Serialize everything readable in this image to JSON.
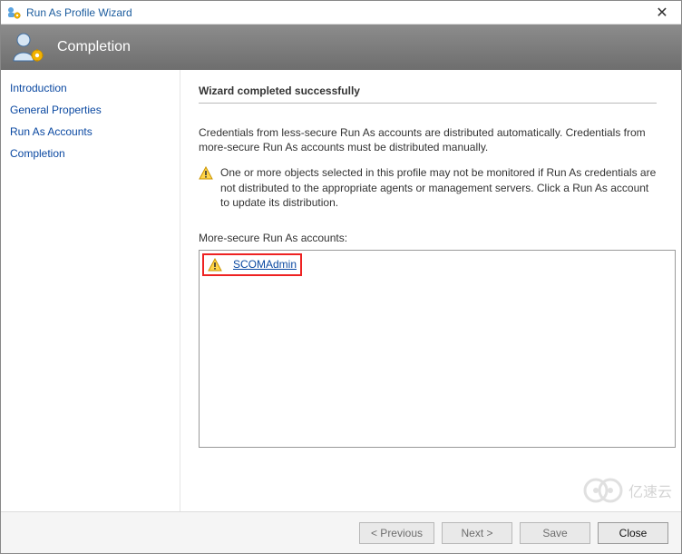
{
  "window": {
    "title": "Run As Profile Wizard"
  },
  "header": {
    "heading": "Completion"
  },
  "sidebar": {
    "items": [
      {
        "label": "Introduction"
      },
      {
        "label": "General Properties"
      },
      {
        "label": "Run As Accounts"
      },
      {
        "label": "Completion"
      }
    ]
  },
  "main": {
    "title": "Wizard completed successfully",
    "description": "Credentials from less-secure Run As accounts are distributed automatically. Credentials from more-secure Run As accounts must be distributed manually.",
    "warning": "One or more objects selected in this profile may not be monitored if Run As credentials are not distributed to the appropriate agents or management servers. Click a Run As account to update its distribution.",
    "accounts_label": "More-secure Run As accounts:",
    "accounts": [
      {
        "name": "SCOMAdmin"
      }
    ]
  },
  "footer": {
    "previous": "< Previous",
    "next": "Next >",
    "save": "Save",
    "close": "Close"
  },
  "watermark": {
    "text": "亿速云"
  },
  "icons": {
    "app": "app-icon",
    "user_gear": "user-gear-icon",
    "warning": "warning-icon",
    "close": "close-icon"
  }
}
